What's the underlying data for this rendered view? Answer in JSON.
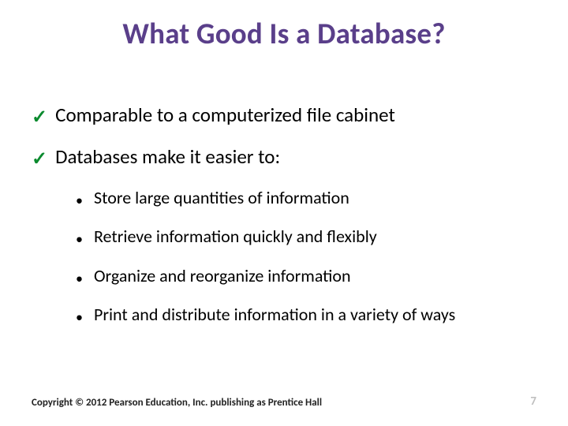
{
  "title": "What Good Is a Database?",
  "points": {
    "p0": "Comparable to a computerized file cabinet",
    "p1": "Databases make it easier to:"
  },
  "subpoints": {
    "s0": "Store large quantities of information",
    "s1": "Retrieve information quickly and flexibly",
    "s2": "Organize and reorganize information",
    "s3": "Print and distribute information in a variety of ways"
  },
  "footer": {
    "copyright": "Copyright © 2012 Pearson Education, Inc. publishing as Prentice Hall",
    "page": "7"
  }
}
